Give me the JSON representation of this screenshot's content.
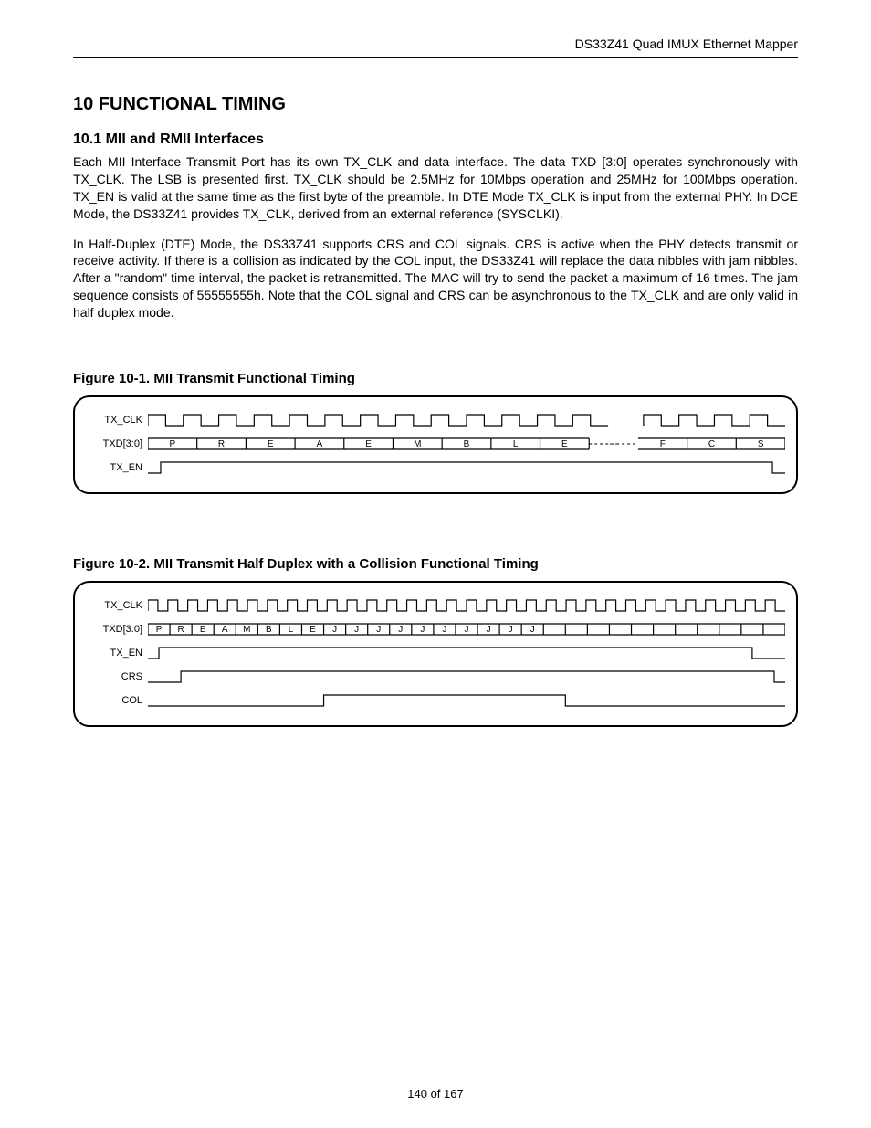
{
  "header": {
    "doc_title": "DS33Z41 Quad IMUX Ethernet Mapper"
  },
  "section": {
    "h1": "10 FUNCTIONAL TIMING",
    "h2": "10.1  MII and RMII Interfaces",
    "para1": "Each MII Interface Transmit Port has its own TX_CLK and data interface. The data TXD [3:0] operates synchronously with TX_CLK. The LSB is presented first. TX_CLK should be 2.5MHz for 10Mbps operation and 25MHz for 100Mbps operation. TX_EN is valid at the same time as the first byte of the preamble. In DTE Mode TX_CLK is input from the external PHY. In DCE Mode, the DS33Z41 provides TX_CLK, derived from an external reference (SYSCLKI).",
    "para2": "In Half-Duplex (DTE) Mode, the DS33Z41 supports CRS and COL signals. CRS is active when the PHY detects transmit or receive activity. If there is a collision as indicated by the COL input, the DS33Z41 will replace the data nibbles with jam nibbles. After a \"random\" time interval, the packet is retransmitted. The MAC will try to send the packet a maximum of 16 times. The jam sequence consists of 55555555h. Note that the COL signal and CRS can be asynchronous to the TX_CLK and are only valid in half duplex mode."
  },
  "figures": {
    "fig1": {
      "caption": "Figure 10-1. MII Transmit Functional Timing",
      "signals": {
        "tx_clk": "TX_CLK",
        "txd": "TXD[3:0]",
        "tx_en": "TX_EN"
      },
      "data_nibbles": [
        "P",
        "R",
        "E",
        "A",
        "E",
        "M",
        "B",
        "L",
        "E",
        "- -",
        "F",
        "C",
        "S"
      ]
    },
    "fig2": {
      "caption": "Figure 10-2. MII Transmit Half Duplex with a Collision Functional Timing",
      "signals": {
        "tx_clk": "TX_CLK",
        "txd": "TXD[3:0]",
        "tx_en": "TX_EN",
        "crs": "CRS",
        "col": "COL"
      },
      "data_nibbles": [
        "P",
        "R",
        "E",
        "A",
        "M",
        "B",
        "L",
        "E",
        "J",
        "J",
        "J",
        "J",
        "J",
        "J",
        "J",
        "J",
        "J",
        "J",
        "",
        "",
        "",
        "",
        "",
        "",
        "",
        "",
        "",
        "",
        ""
      ]
    }
  },
  "footer": {
    "page_no": "140 of 167"
  },
  "chart_data": [
    {
      "type": "table",
      "title": "Figure 10-1 MII Transmit Functional Timing — signal states",
      "signals": [
        {
          "name": "TX_CLK",
          "description": "continuous clock; gap after 9th data cell then resumes"
        },
        {
          "name": "TXD[3:0]",
          "sequence": [
            "P",
            "R",
            "E",
            "A",
            "E",
            "M",
            "B",
            "L",
            "E",
            "--",
            "F",
            "C",
            "S"
          ]
        },
        {
          "name": "TX_EN",
          "description": "low then rises at first nibble, stays high through FCS, then low"
        }
      ]
    },
    {
      "type": "table",
      "title": "Figure 10-2 MII Transmit Half Duplex with Collision — signal states",
      "signals": [
        {
          "name": "TX_CLK",
          "description": "continuous clock full width"
        },
        {
          "name": "TXD[3:0]",
          "sequence": [
            "P",
            "R",
            "E",
            "A",
            "M",
            "B",
            "L",
            "E",
            "J",
            "J",
            "J",
            "J",
            "J",
            "J",
            "J",
            "J",
            "J",
            "J"
          ],
          "then": "idle cells"
        },
        {
          "name": "TX_EN",
          "description": "rises at P, stays high through jam nibbles, falls near right edge"
        },
        {
          "name": "CRS",
          "description": "rises shortly after TX_EN, stays high, falls at far right"
        },
        {
          "name": "COL",
          "description": "low, rises after preamble (around first J), stays high to ~2/3 width, falls"
        }
      ]
    }
  ]
}
